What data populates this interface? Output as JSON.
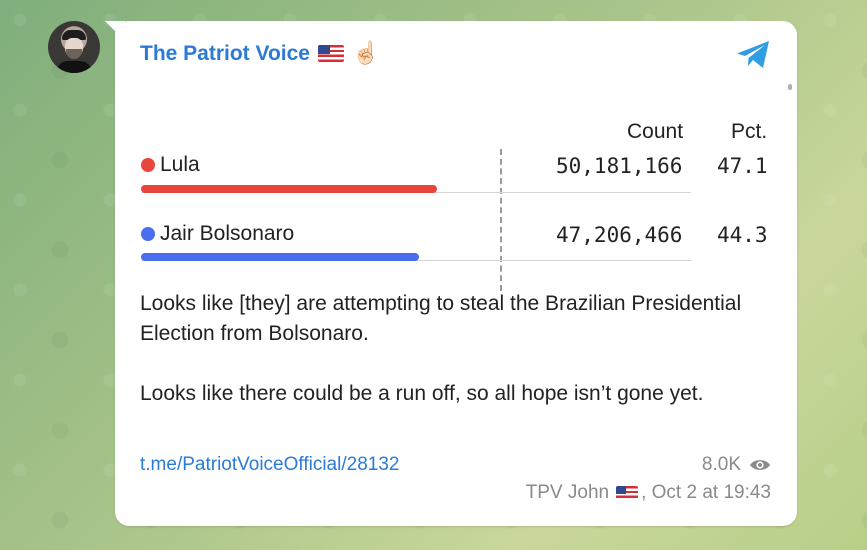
{
  "channel": {
    "name": "The Patriot Voice",
    "name_emoji": "☝🏻",
    "avatar_icon": "channel-avatar",
    "app_icon": "telegram-icon"
  },
  "table": {
    "headers": {
      "count": "Count",
      "pct": "Pct."
    },
    "rows": [
      {
        "name": "Lula",
        "count": "50,181,166",
        "pct": "47.1",
        "color": "#e8453c",
        "bar_fraction": 0.471
      },
      {
        "name": "Jair Bolsonaro",
        "count": "47,206,466",
        "pct": "44.3",
        "color": "#4a6ef0",
        "bar_fraction": 0.443
      }
    ]
  },
  "message": {
    "paragraph1": "Looks like [they] are attempting to steal the Brazilian Presidential Election from Bolsonaro.",
    "paragraph2": "Looks like there could be a run off, so all hope isn’t gone yet."
  },
  "post": {
    "link": "t.me/PatriotVoiceOfficial/28132",
    "views": "8.0K",
    "author": "TPV John",
    "date": ", Oct 2 at 19:43"
  },
  "colors": {
    "accent": "#2b7bd6",
    "muted": "#8a8a8a"
  }
}
